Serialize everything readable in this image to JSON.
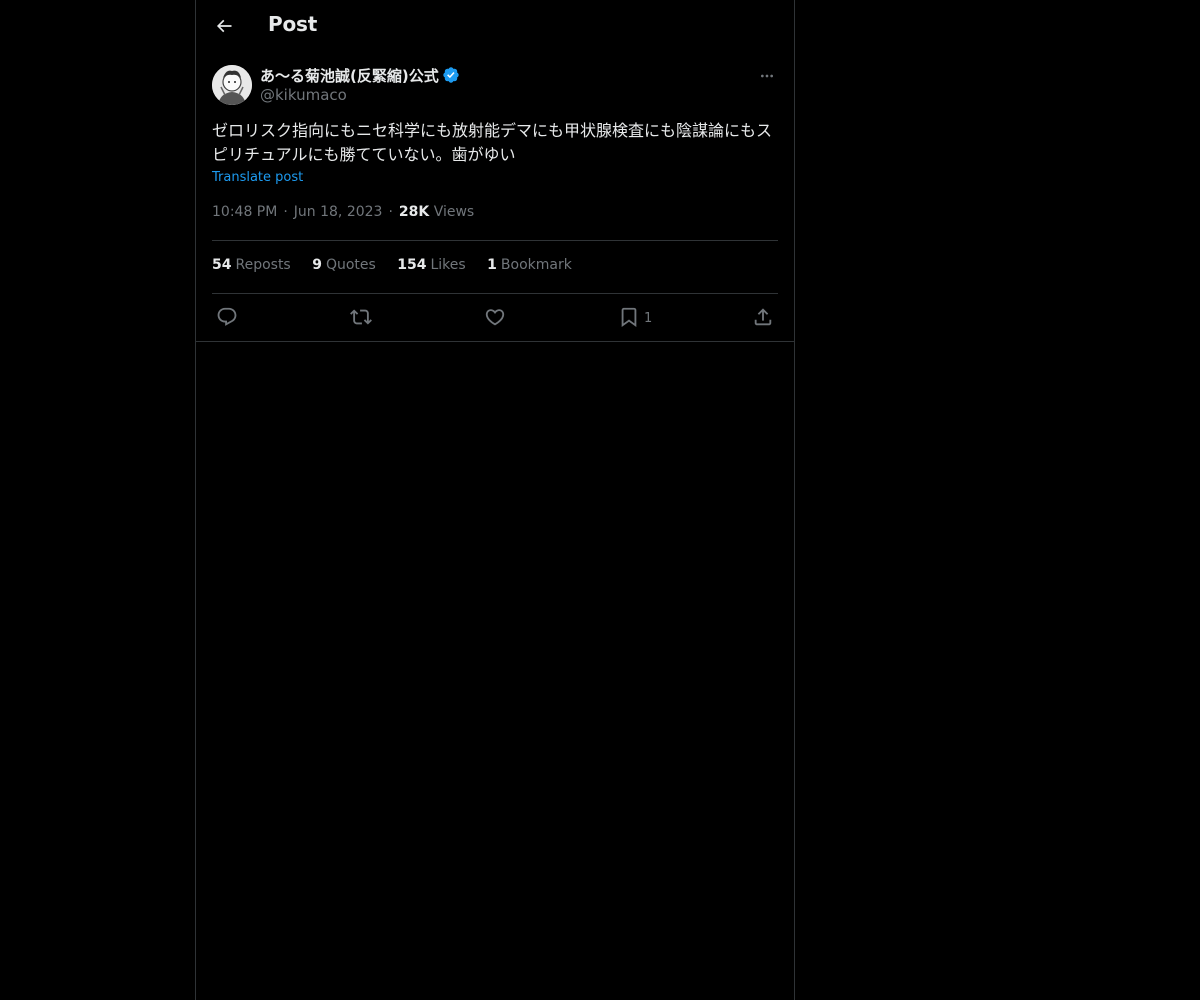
{
  "header": {
    "title": "Post"
  },
  "post": {
    "author": {
      "display_name": "あ〜る菊池誠(反緊縮)公式",
      "handle": "@kikumaco",
      "verified": true
    },
    "text": "ゼロリスク指向にもニセ科学にも放射能デマにも甲状腺検査にも陰謀論にもスピリチュアルにも勝てていない。歯がゆい",
    "translate_label": "Translate post",
    "time": "10:48 PM",
    "date": "Jun 18, 2023",
    "views_count": "28K",
    "views_label": "Views",
    "stats": {
      "reposts_count": "54",
      "reposts_label": "Reposts",
      "quotes_count": "9",
      "quotes_label": "Quotes",
      "likes_count": "154",
      "likes_label": "Likes",
      "bookmarks_count": "1",
      "bookmarks_label": "Bookmark"
    },
    "actions": {
      "bookmark_count": "1"
    }
  },
  "colors": {
    "background": "#000000",
    "text": "#e7e9ea",
    "muted": "#71767b",
    "accent": "#1d9bf0",
    "border": "#2f3336"
  },
  "icons": {
    "back": "arrow-left-icon",
    "verified": "verified-badge-icon",
    "more": "more-horizontal-icon",
    "reply": "reply-icon",
    "repost": "repost-icon",
    "like": "heart-icon",
    "bookmark": "bookmark-icon",
    "share": "share-icon"
  }
}
